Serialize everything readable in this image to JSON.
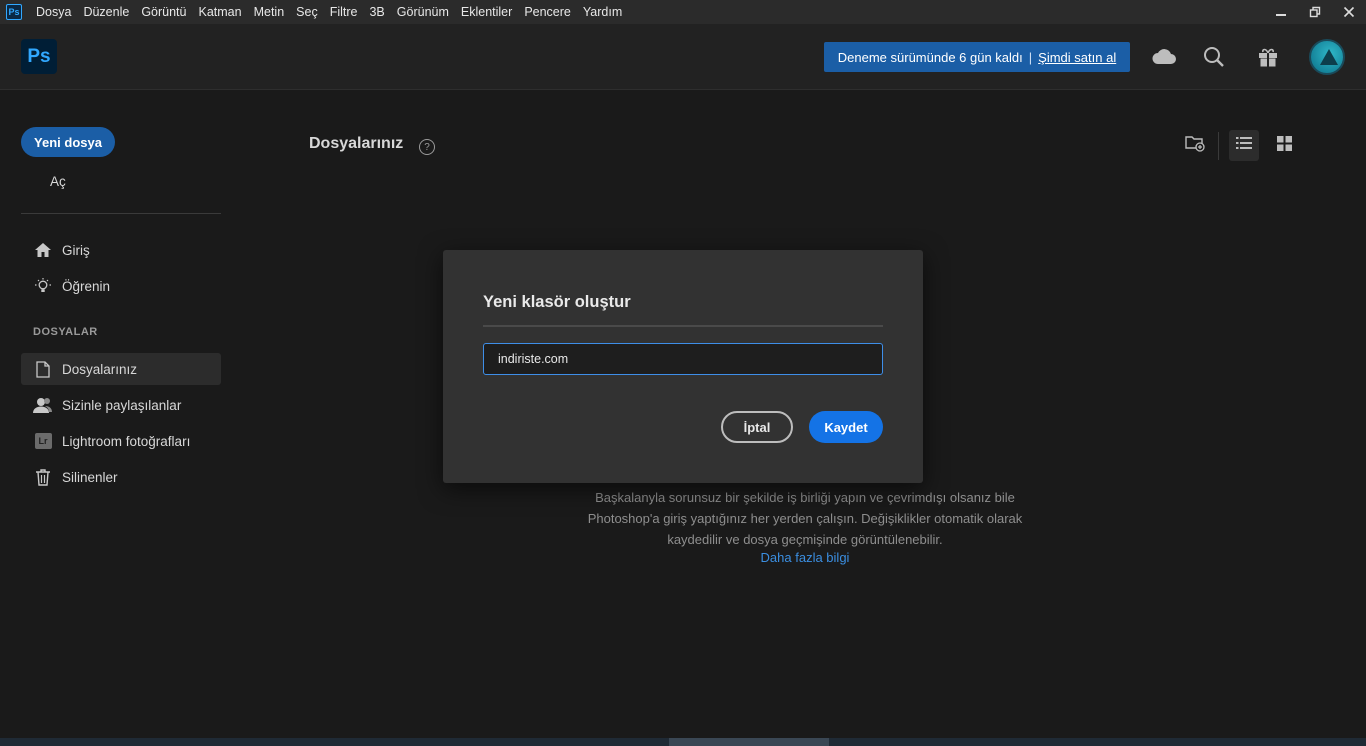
{
  "menubar": {
    "app_icon": "Ps",
    "items": [
      "Dosya",
      "Düzenle",
      "Görüntü",
      "Katman",
      "Metin",
      "Seç",
      "Filtre",
      "3B",
      "Görünüm",
      "Eklentiler",
      "Pencere",
      "Yardım"
    ],
    "window_controls": [
      "minimize-icon",
      "restore-icon",
      "close-icon"
    ]
  },
  "header": {
    "logo": "Ps",
    "trial_text": "Deneme sürümünde 6 gün kaldı",
    "trial_separator": "|",
    "trial_buy": "Şimdi satın al",
    "icons": [
      "cloud-icon",
      "search-icon",
      "gift-icon"
    ]
  },
  "sidebar": {
    "new_file": "Yeni dosya",
    "open": "Aç",
    "nav": [
      {
        "label": "Giriş",
        "icon": "home-icon"
      },
      {
        "label": "Öğrenin",
        "icon": "lightbulb-icon"
      }
    ],
    "section_label": "DOSYALAR",
    "files_nav": [
      {
        "label": "Dosyalarınız",
        "icon": "file-icon",
        "active": true
      },
      {
        "label": "Sizinle paylaşılanlar",
        "icon": "users-icon"
      },
      {
        "label": "Lightroom fotoğrafları",
        "icon": "lightroom-icon",
        "badge": "Lr"
      },
      {
        "label": "Silinenler",
        "icon": "trash-icon"
      }
    ]
  },
  "main": {
    "title": "Dosyalarınız",
    "help": "?",
    "empty_description": "Başkalanyla sorunsuz bir şekilde iş birliği yapın ve çevrimdışı olsanız bile Photoshop'a giriş yaptığınız her yerden çalışın. Değişiklikler otomatik olarak kaydedilir ve dosya geçmişinde görüntülenebilir.",
    "more_link": "Daha fazla bilgi"
  },
  "dialog": {
    "title": "Yeni klasör oluştur",
    "input_value": "indiriste.com",
    "cancel": "İptal",
    "save": "Kaydet"
  },
  "colors": {
    "accent": "#1473e6",
    "trial_banner": "#1b5ea6",
    "background": "#1a1a1a",
    "dialog": "#323232"
  }
}
